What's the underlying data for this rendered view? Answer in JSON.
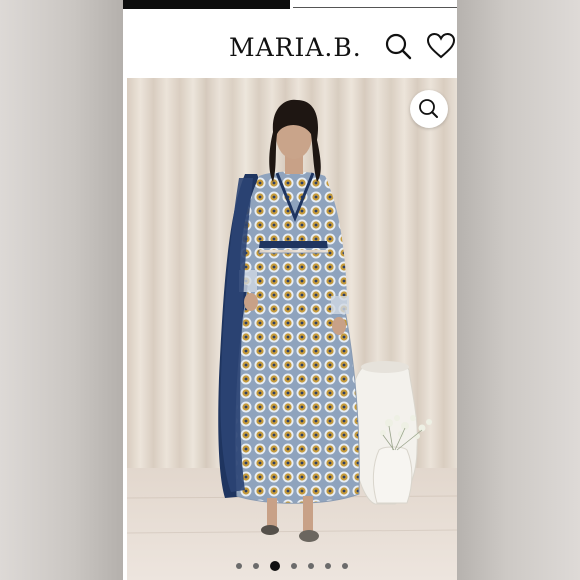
{
  "header": {
    "logo": "MARIA.B.",
    "search_icon": "search-icon",
    "wishlist_icon": "heart-icon"
  },
  "gallery": {
    "zoom_icon": "zoom-search-icon",
    "slide_count": 7,
    "active_slide": 3
  },
  "progress": {
    "fraction": 0.5
  },
  "colors": {
    "background": "#ffffff",
    "text": "#111111",
    "curtain": "#e4dbd0",
    "floor": "#e9e1da"
  }
}
